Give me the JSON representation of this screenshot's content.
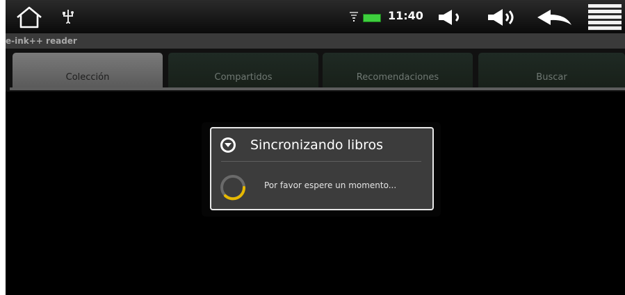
{
  "status_bar": {
    "time": "11:40",
    "icons": [
      "home-icon",
      "usb-icon",
      "wifi-icon",
      "battery-icon",
      "volume-down-icon",
      "volume-up-icon",
      "back-icon",
      "menu-icon"
    ]
  },
  "app": {
    "title": "e-ink++ reader"
  },
  "tabs": [
    {
      "label": "Colección",
      "active": true
    },
    {
      "label": "Compartidos",
      "active": false
    },
    {
      "label": "Recomendaciones",
      "active": false
    },
    {
      "label": "Buscar",
      "active": false
    }
  ],
  "dialog": {
    "title": "Sincronizando libros",
    "message": "Por favor espere un momento...",
    "icon": "chevron-down-circle-icon",
    "spinner": "loading-spinner"
  },
  "colors": {
    "battery": "#3ecf3e",
    "spinner_accent": "#e6b800",
    "active_tab": "#6a6a6a"
  }
}
